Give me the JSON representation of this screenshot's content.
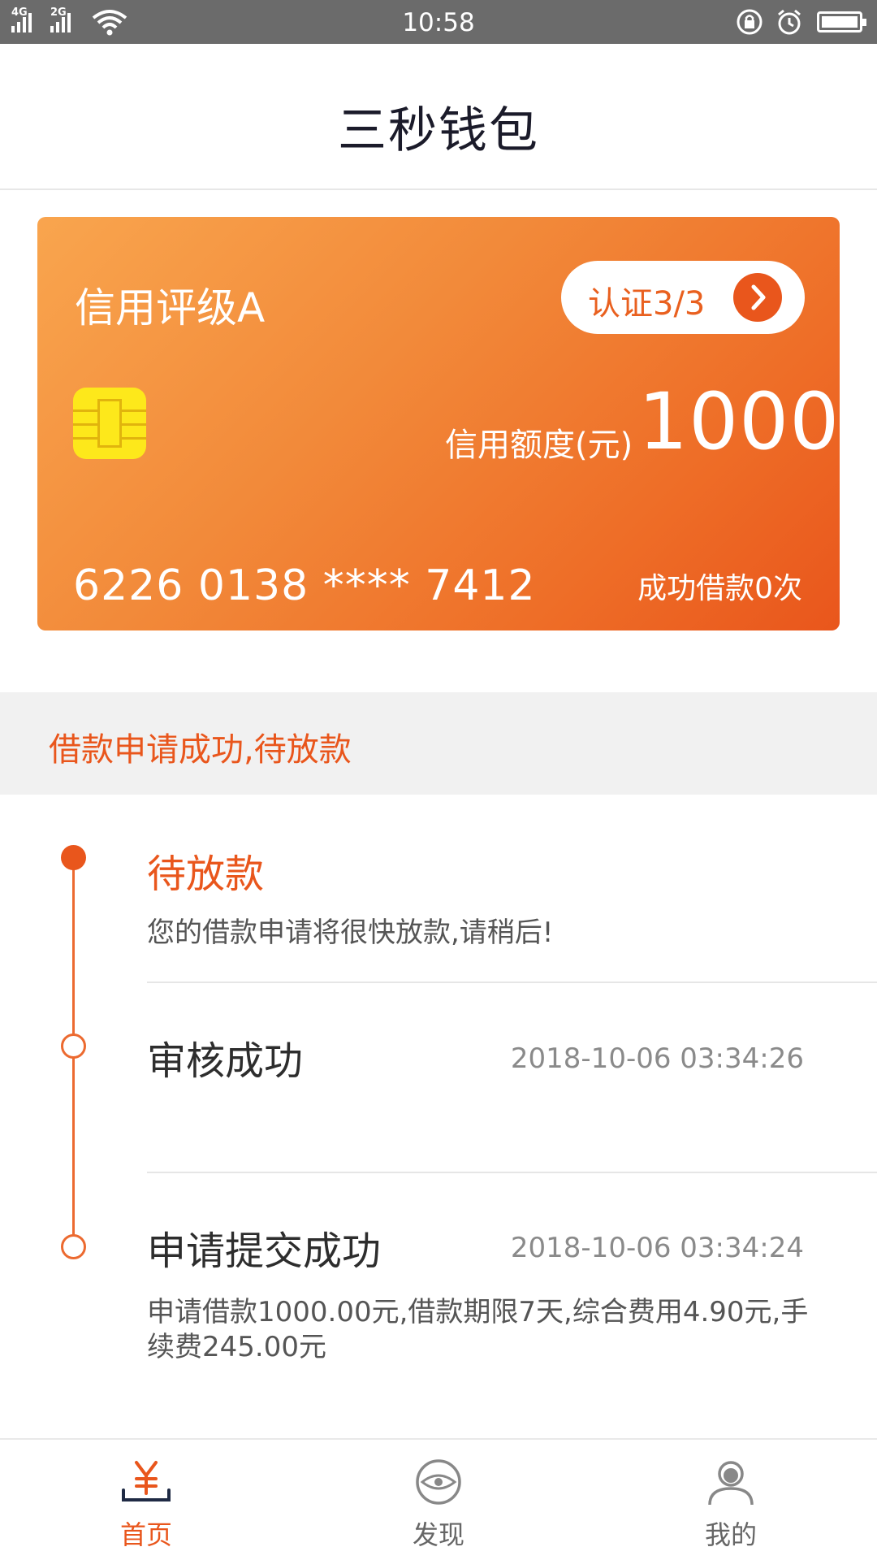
{
  "status_bar": {
    "time": "10:58",
    "sim1": "4G",
    "sim2": "2G"
  },
  "header": {
    "title": "三秒钱包"
  },
  "card": {
    "rating": "信用评级A",
    "cert_label": "认证3/3",
    "limit_label": "信用额度(元)",
    "limit_value": "1000",
    "card_number": "6226 0138 **** 7412",
    "loans_count": "成功借款0次",
    "gradient_colors": [
      "#f9a54e",
      "#e9561c"
    ]
  },
  "banner": {
    "text": "借款申请成功,待放款"
  },
  "timeline": {
    "steps": [
      {
        "title": "待放款",
        "desc": "您的借款申请将很快放款,请稍后!",
        "time": "",
        "state": "active"
      },
      {
        "title": "审核成功",
        "desc": "",
        "time": "2018-10-06 03:34:26",
        "state": "done"
      },
      {
        "title": "申请提交成功",
        "desc_line1": "申请借款1000.00元,借款期限7天,综合费用4.90元,手",
        "desc_line2": "续费245.00元",
        "time": "2018-10-06 03:34:24",
        "state": "done"
      }
    ]
  },
  "bottom_nav": {
    "items": [
      {
        "label": "首页",
        "icon": "yuan-icon",
        "active": true
      },
      {
        "label": "发现",
        "icon": "eye-icon",
        "active": false
      },
      {
        "label": "我的",
        "icon": "user-icon",
        "active": false
      }
    ]
  },
  "colors": {
    "accent": "#e9561c",
    "status_bar": "#6b6b6b",
    "chip": "#fde81b"
  }
}
